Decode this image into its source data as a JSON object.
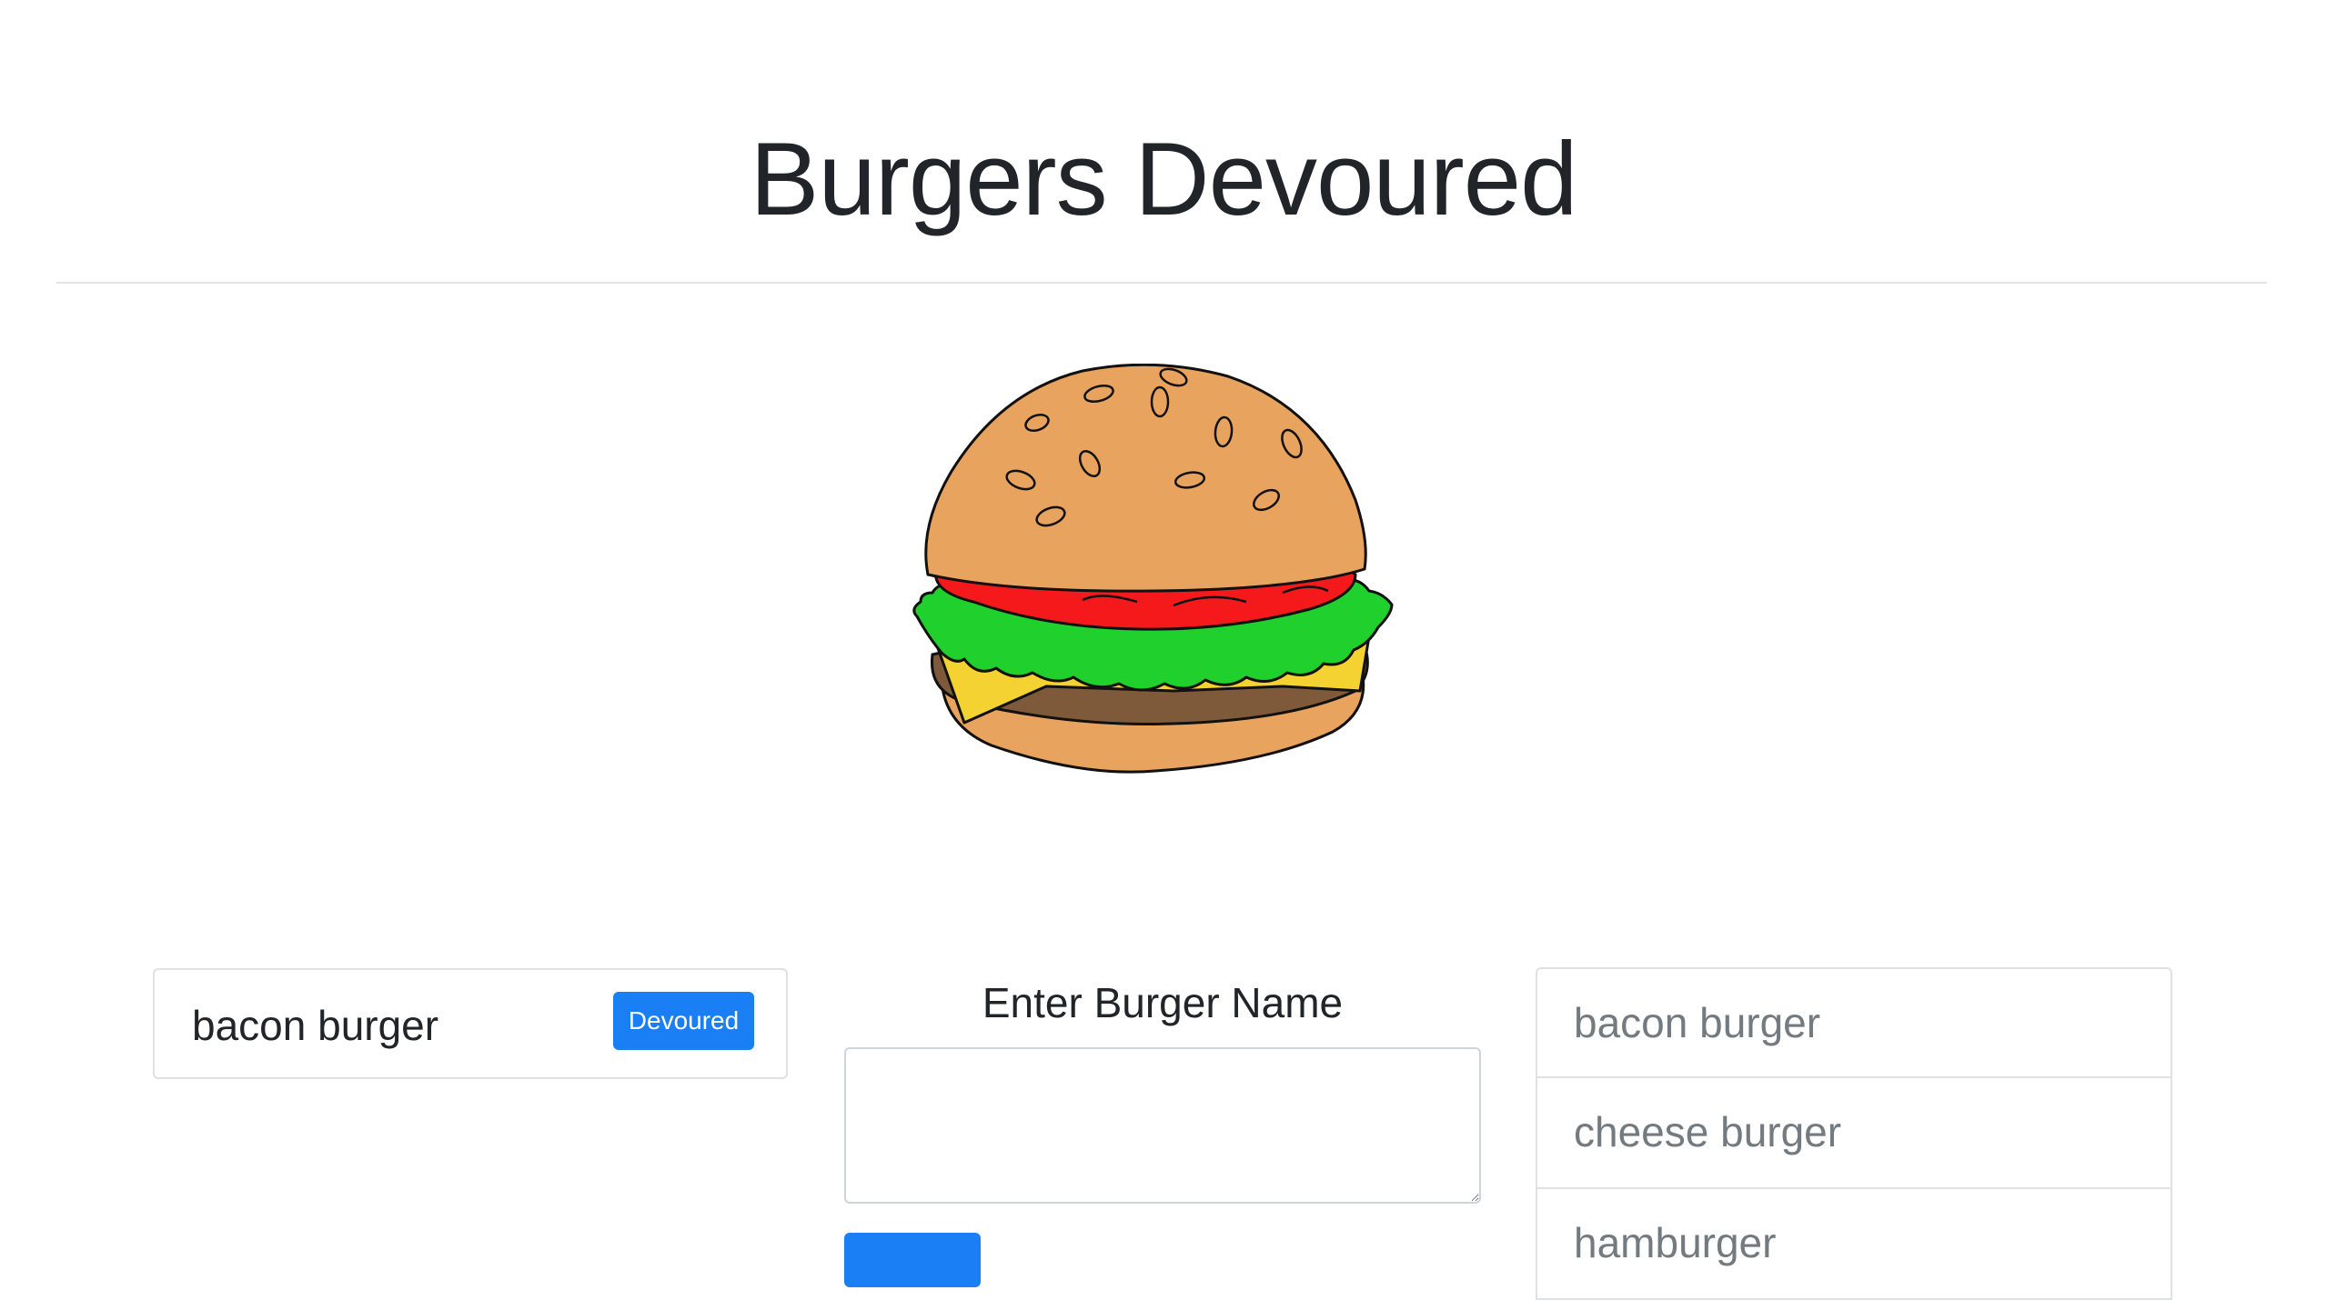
{
  "header": {
    "title": "Burgers Devoured"
  },
  "devoured": {
    "items": [
      {
        "name": "bacon burger",
        "button_label": "Devoured"
      }
    ]
  },
  "form": {
    "label": "Enter Burger Name",
    "textarea_value": "",
    "submit_label": ""
  },
  "burger_list": {
    "items": [
      {
        "name": "bacon burger"
      },
      {
        "name": "cheese burger"
      },
      {
        "name": "hamburger"
      }
    ]
  },
  "colors": {
    "accent": "#1a7ff5",
    "bun": "#e8a35e",
    "tomato": "#f5191c",
    "lettuce": "#20d02c",
    "cheese": "#f3d232",
    "patty": "#7f5a3a"
  },
  "image": {
    "icon": "burger-illustration-icon"
  }
}
